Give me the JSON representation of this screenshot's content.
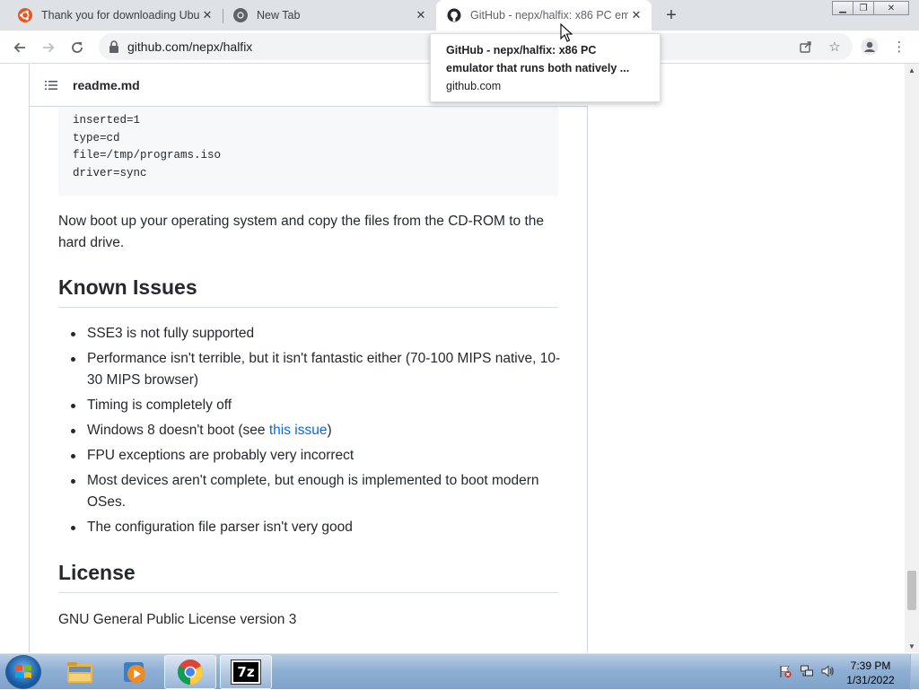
{
  "browser": {
    "tabs": [
      {
        "title": "Thank you for downloading Ubu",
        "favicon": "ubuntu-icon"
      },
      {
        "title": "New Tab",
        "favicon": "chrome-icon"
      },
      {
        "title": "GitHub - nepx/halfix: x86 PC emu",
        "favicon": "github-icon"
      }
    ],
    "active_tab": 2,
    "url": "github.com/nepx/halfix"
  },
  "tooltip": {
    "title": "GitHub - nepx/halfix: x86 PC emulator that runs both natively ...",
    "url": "github.com"
  },
  "readme": {
    "filename": "readme.md",
    "code_lines": [
      "inserted=1",
      "type=cd",
      "file=/tmp/programs.iso",
      "driver=sync"
    ],
    "boot_paragraph": "Now boot up your operating system and copy the files from the CD-ROM to the hard drive.",
    "known_issues_heading": "Known Issues",
    "issues": [
      "SSE3 is not fully supported",
      "Performance isn't terrible, but it isn't fantastic either (70-100 MIPS native, 10-30 MIPS browser)",
      "Timing is completely off",
      "FPU exceptions are probably very incorrect",
      "Most devices aren't complete, but enough is implemented to boot modern OSes.",
      "The configuration file parser isn't very good"
    ],
    "win8_issue_prefix": "Windows 8 doesn't boot (see ",
    "win8_issue_link": "this issue",
    "win8_issue_suffix": ")",
    "license_heading": "License",
    "license_text": "GNU General Public License version 3"
  },
  "taskbar": {
    "time": "7:39 PM",
    "date": "1/31/2022",
    "pinned": [
      "explorer-icon",
      "media-player-icon",
      "chrome-icon",
      "7zip-icon"
    ],
    "sevenzip_label": "7z"
  },
  "colors": {
    "link": "#0969da",
    "text": "#24292f",
    "tabstrip": "#dee1e6"
  }
}
